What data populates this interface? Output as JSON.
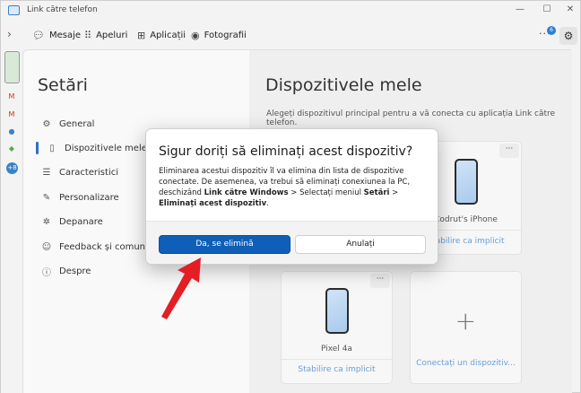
{
  "window": {
    "title": "Link către telefon",
    "controls": {
      "minimize": "—",
      "maximize": "☐",
      "close": "✕"
    }
  },
  "nav": {
    "items": [
      {
        "label": "Mesaje",
        "icon": "chat-icon"
      },
      {
        "label": "Apeluri",
        "icon": "dialpad-icon"
      },
      {
        "label": "Aplicații",
        "icon": "apps-icon"
      },
      {
        "label": "Fotografii",
        "icon": "photos-icon"
      }
    ],
    "more": "···",
    "notification_count": "6"
  },
  "settings": {
    "title": "Setări",
    "items": [
      {
        "label": "General",
        "icon": "⚙"
      },
      {
        "label": "Dispozitivele mele",
        "icon": "▯",
        "active": true
      },
      {
        "label": "Caracteristici",
        "icon": "☰"
      },
      {
        "label": "Personalizare",
        "icon": "✎"
      },
      {
        "label": "Depanare",
        "icon": "✲"
      },
      {
        "label": "Feedback și comunitate",
        "icon": "☺"
      },
      {
        "label": "Despre",
        "icon": "ⓘ"
      }
    ]
  },
  "devices": {
    "title": "Dispozitivele mele",
    "subtitle": "Alegeți dispozitivul principal pentru a vă conecta cu aplicația Link către telefon.",
    "cards": [
      {
        "name": "Codrut's iPhone",
        "action": "Stabilire ca implicit"
      },
      {
        "name": "Pixel 4a",
        "action": "Stabilire ca implicit"
      }
    ],
    "add_card": {
      "label": "Conectați un dispozitiv..."
    },
    "more": "···"
  },
  "dialog": {
    "title": "Sigur doriți să eliminați acest dispozitiv?",
    "body_part1": "Eliminarea acestui dispozitiv îl va elimina din lista de dispozitive conectate. De asemenea, va trebui să eliminați conexiunea la PC, deschizând ",
    "body_bold1": "Link către Windows",
    "body_part2": " > Selectați meniul ",
    "body_bold2": "Setări",
    "body_part3": " > ",
    "body_bold3": "Eliminați acest dispozitiv",
    "body_part4": ".",
    "confirm_label": "Da, se elimină",
    "cancel_label": "Anulați"
  },
  "colors": {
    "accent": "#0f5fb8",
    "arrow": "#e31e24",
    "link": "#6a9fd6"
  }
}
